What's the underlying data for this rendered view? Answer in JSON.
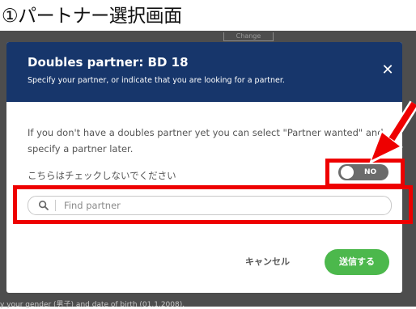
{
  "caption": "①パートナー選択画面",
  "background": {
    "change_label": "Change",
    "footer_text": "y your gender (男子) and date of birth (01.1.2008)."
  },
  "modal": {
    "title": "Doubles partner: BD 18",
    "subtitle": "Specify your partner, or indicate that you are looking for a partner.",
    "close_icon": "close-icon",
    "description": "If you don't have a doubles partner yet you can select \"Partner wanted\" and specify a partner later.",
    "check_label": "こちらはチェックしないでください",
    "toggle": {
      "state_text": "NO",
      "on": false
    },
    "search": {
      "placeholder": "Find partner",
      "value": "",
      "icon": "search-icon"
    },
    "cancel_label": "キャンセル",
    "submit_label": "送信する"
  },
  "colors": {
    "header": "#17366b",
    "submit": "#4cb84c",
    "annotation": "#ee0000",
    "backdrop": "#4d4d4d"
  }
}
